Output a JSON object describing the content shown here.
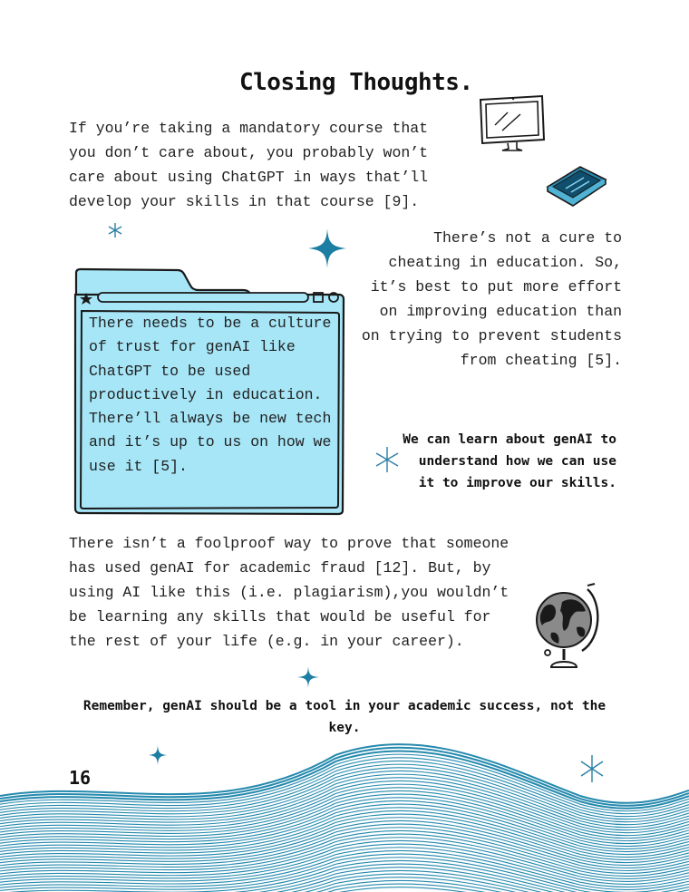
{
  "page": {
    "title": "Closing Thoughts.",
    "paragraph_1": "If you’re taking a mandatory course that you don’t care about, you probably won’t care about using ChatGPT in ways that’ll develop your skills in that course [9].",
    "paragraph_2": "There’s not a cure to cheating in education. So, it’s best to put more effort on improving education than on trying to prevent students from cheating [5].",
    "folder_text": "There needs to be a culture of trust for genAI like ChatGPT to be used productively in education. There’ll always be new tech and it’s up to us on how we use it [5].",
    "emphasis_1": "We can learn about genAI to understand how we can use it to improve  our skills.",
    "paragraph_3": "There isn’t a foolproof way to prove that someone has used genAI for academic fraud [12]. But, by using AI like this (i.e. plagiarism),you wouldn’t be learning any skills that would be useful for the rest of your life (e.g. in your career).",
    "emphasis_2": "Remember, genAI should be a tool in your academic success, not the key.",
    "page_number": "16"
  },
  "colors": {
    "accent": "#1f7fa0",
    "folder_fill": "#a6e6f7",
    "ink": "#1a1a1a",
    "wave": "#2489ad"
  },
  "icons": [
    "computer-monitor-icon",
    "tablet-icon",
    "globe-icon",
    "sparkle-icon",
    "star-icon"
  ]
}
